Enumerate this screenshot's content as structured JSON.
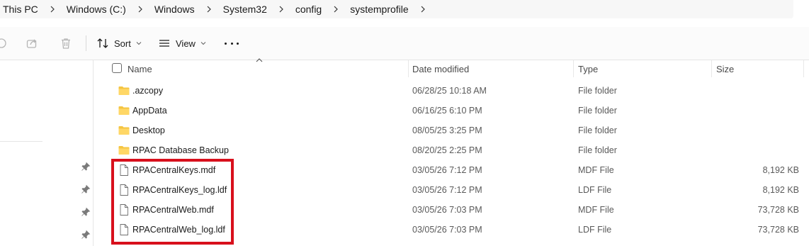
{
  "breadcrumb": {
    "items": [
      "This PC",
      "Windows (C:)",
      "Windows",
      "System32",
      "config",
      "systemprofile"
    ]
  },
  "toolbar": {
    "sort_label": "Sort",
    "view_label": "View",
    "icons": [
      "copy-icon",
      "share-icon",
      "delete-icon",
      "sort-icon",
      "view-icon",
      "more-options-icon"
    ]
  },
  "columns": {
    "name": "Name",
    "date_modified": "Date modified",
    "type": "Type",
    "size": "Size"
  },
  "files": [
    {
      "name": ".azcopy",
      "date": "06/28/25 10:18 AM",
      "type": "File folder",
      "size": "",
      "icon": "folder-icon"
    },
    {
      "name": "AppData",
      "date": "06/16/25 6:10 PM",
      "type": "File folder",
      "size": "",
      "icon": "folder-icon"
    },
    {
      "name": "Desktop",
      "date": "08/05/25 3:25 PM",
      "type": "File folder",
      "size": "",
      "icon": "folder-icon"
    },
    {
      "name": "RPAC Database Backup",
      "date": "08/20/25 2:25 PM",
      "type": "File folder",
      "size": "",
      "icon": "folder-icon"
    },
    {
      "name": "RPACentralKeys.mdf",
      "date": "03/05/26 7:12 PM",
      "type": "MDF File",
      "size": "8,192 KB",
      "icon": "file-icon"
    },
    {
      "name": "RPACentralKeys_log.ldf",
      "date": "03/05/26 7:12 PM",
      "type": "LDF File",
      "size": "8,192 KB",
      "icon": "file-icon"
    },
    {
      "name": "RPACentralWeb.mdf",
      "date": "03/05/26 7:03 PM",
      "type": "MDF File",
      "size": "73,728 KB",
      "icon": "file-icon"
    },
    {
      "name": "RPACentralWeb_log.ldf",
      "date": "03/05/26 7:03 PM",
      "type": "LDF File",
      "size": "73,728 KB",
      "icon": "file-icon"
    }
  ],
  "colors": {
    "highlight": "#d8101c",
    "folder": "#f5c542"
  }
}
